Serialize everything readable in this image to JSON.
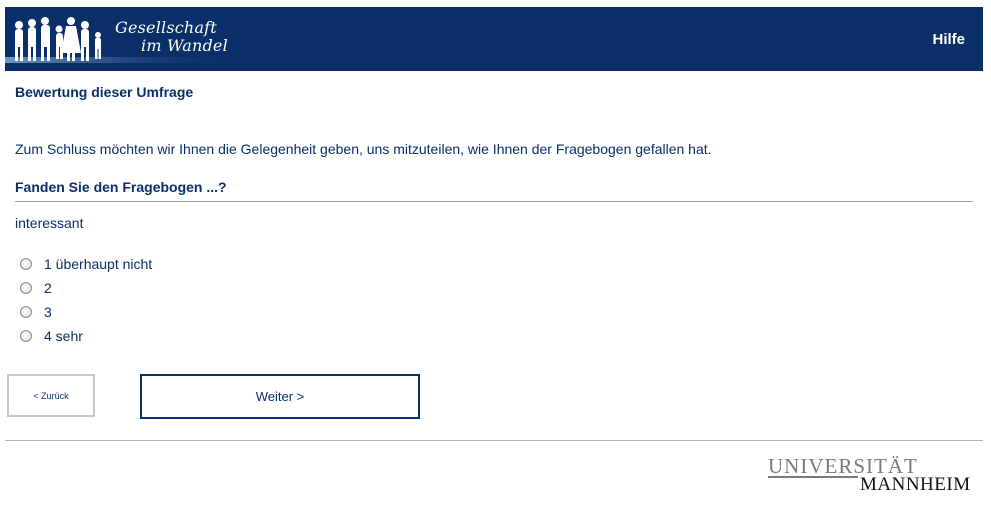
{
  "header": {
    "logo_line1": "Gesellschaft",
    "logo_line2": "im Wandel",
    "help_label": "Hilfe",
    "background": "#0a2f69"
  },
  "main": {
    "section_title": "Bewertung dieser Umfrage",
    "intro": "Zum Schluss möchten wir Ihnen die Gelegenheit geben, uns mitzuteilen, wie Ihnen der Fragebogen gefallen hat.",
    "question": "Fanden Sie den Fragebogen ...?",
    "item_label": "interessant",
    "options": [
      {
        "label": "1 überhaupt nicht"
      },
      {
        "label": "2"
      },
      {
        "label": "3"
      },
      {
        "label": "4 sehr"
      }
    ]
  },
  "nav": {
    "back_label": "< Zurück",
    "next_label": "Weiter >"
  },
  "footer": {
    "university_line1": "UNIVERSITÄT",
    "university_line2": "MANNHEIM"
  }
}
